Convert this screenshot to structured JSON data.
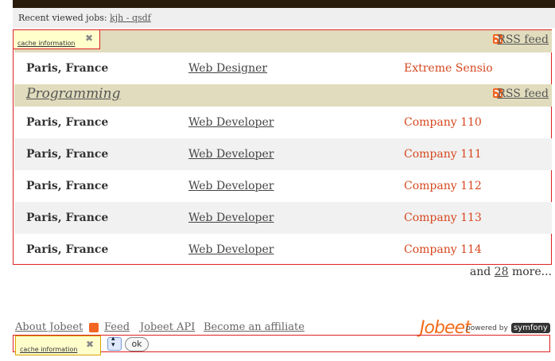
{
  "recent": {
    "label": "Recent viewed jobs:",
    "link": "kjh - qsdf"
  },
  "cache_info": {
    "label": "cache information",
    "close": "✖"
  },
  "categories": [
    {
      "title": "",
      "rss": "RSS feed",
      "jobs": [
        {
          "location": "Paris, France",
          "position": "Web Designer",
          "company": "Extreme Sensio"
        }
      ]
    },
    {
      "title": "Programming",
      "rss": "RSS feed",
      "jobs": [
        {
          "location": "Paris, France",
          "position": "Web Developer",
          "company": "Company 110"
        },
        {
          "location": "Paris, France",
          "position": "Web Developer",
          "company": "Company 111"
        },
        {
          "location": "Paris, France",
          "position": "Web Developer",
          "company": "Company 112"
        },
        {
          "location": "Paris, France",
          "position": "Web Developer",
          "company": "Company 113"
        },
        {
          "location": "Paris, France",
          "position": "Web Developer",
          "company": "Company 114"
        }
      ]
    }
  ],
  "more": {
    "prefix": "and",
    "count": "28",
    "suffix": "more..."
  },
  "footer": {
    "about": "About Jobeet",
    "feed": "Feed",
    "api": "Jobeet API",
    "affiliate": "Become an affiliate",
    "brand": "Jobeet",
    "powered": "powered by",
    "symfony": "symfony",
    "ok": "ok"
  },
  "colors": {
    "category_bg": "#e1dcbd",
    "company": "#d6471e",
    "cache_border": "#dd2222",
    "brand": "#f26b1a"
  }
}
